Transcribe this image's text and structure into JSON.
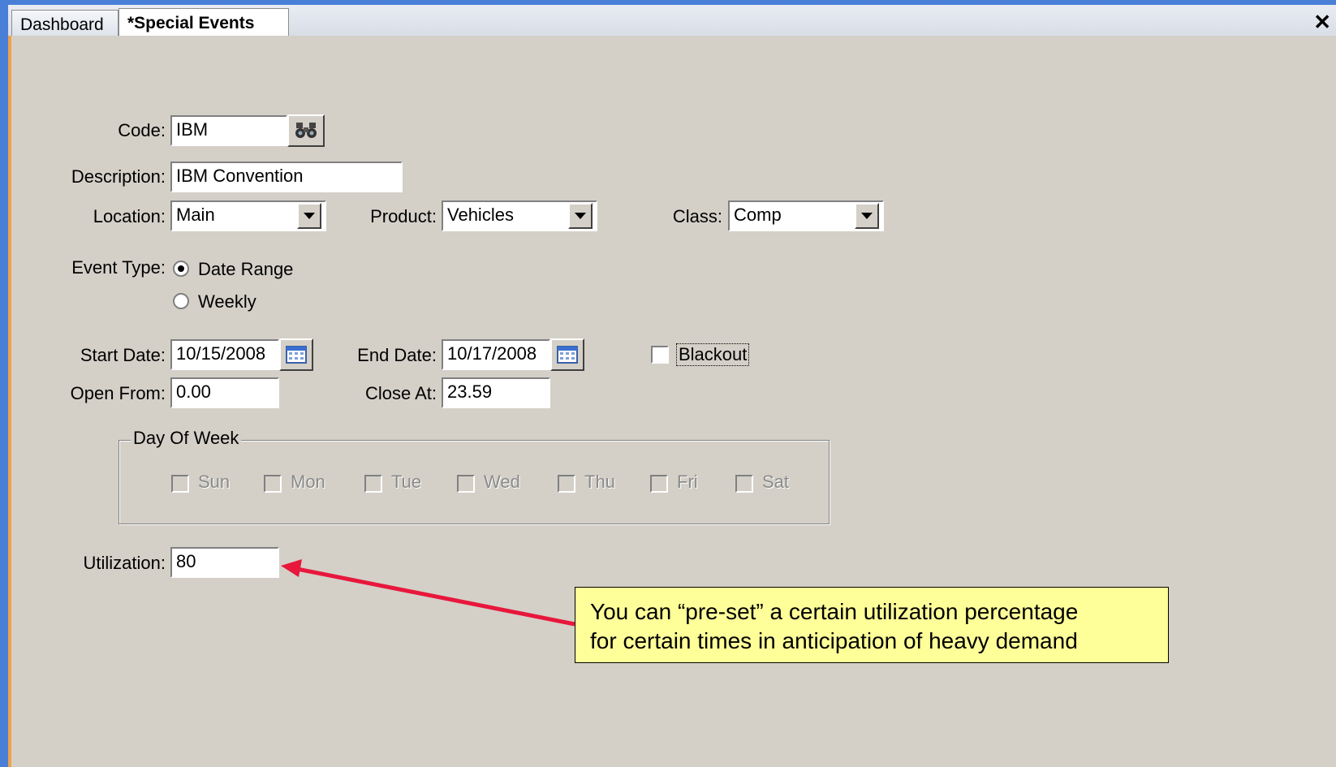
{
  "tabs": [
    {
      "label": "Dashboard"
    },
    {
      "label": "*Special Events"
    }
  ],
  "form": {
    "code_label": "Code:",
    "code_value": "IBM",
    "description_label": "Description:",
    "description_value": "IBM Convention",
    "location_label": "Location:",
    "location_value": "Main",
    "product_label": "Product:",
    "product_value": "Vehicles",
    "class_label": "Class:",
    "class_value": "Comp",
    "event_type_label": "Event Type:",
    "event_type_options": [
      "Date Range",
      "Weekly"
    ],
    "event_type_selected": "Date Range",
    "start_date_label": "Start Date:",
    "start_date_value": "10/15/2008",
    "end_date_label": "End Date:",
    "end_date_value": "10/17/2008",
    "blackout_label": "Blackout",
    "blackout_checked": false,
    "open_from_label": "Open From:",
    "open_from_value": "0.00",
    "close_at_label": "Close At:",
    "close_at_value": "23.59",
    "day_of_week_legend": "Day Of Week",
    "days": [
      "Sun",
      "Mon",
      "Tue",
      "Wed",
      "Thu",
      "Fri",
      "Sat"
    ],
    "utilization_label": "Utilization:",
    "utilization_value": "80"
  },
  "callout": {
    "line1": "You can “pre-set” a certain utilization percentage",
    "line2": "for certain times in anticipation of heavy demand"
  },
  "colors": {
    "panel_bg": "#d4d0c8",
    "callout_bg": "#ffff99",
    "arrow": "#e8173c"
  },
  "icons": {
    "lookup": "binoculars-icon",
    "calendar": "calendar-icon",
    "close": "close-icon"
  }
}
